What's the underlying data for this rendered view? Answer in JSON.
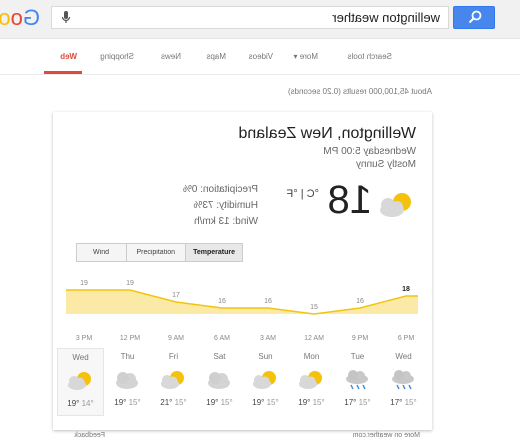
{
  "search": {
    "query": "wellington weather",
    "logo_text": "Google"
  },
  "nav": {
    "items": [
      "Web",
      "Shopping",
      "News",
      "Maps",
      "Videos",
      "More ▾",
      "Search tools"
    ]
  },
  "stats": "About 45,100,000 results (0.20 seconds)",
  "weather": {
    "location": "Wellington, New Zealand",
    "datetime": "Wednesday 5:00 PM",
    "condition": "Mostly Sunny",
    "temperature": "18",
    "units": "°C | °F",
    "precipitation": "Precipitation: 0%",
    "humidity": "Humidity: 73%",
    "wind": "Wind: 13 km/h",
    "tabs": [
      "Temperature",
      "Precipitation",
      "Wind"
    ],
    "selected_tab": "Temperature",
    "days": [
      {
        "name": "Wed",
        "high": "19°",
        "low": "14°",
        "icon": "partly-sunny-icon"
      },
      {
        "name": "Thu",
        "high": "19°",
        "low": "15°",
        "icon": "cloudy-icon"
      },
      {
        "name": "Fri",
        "high": "21°",
        "low": "15°",
        "icon": "partly-sunny-icon"
      },
      {
        "name": "Sat",
        "high": "19°",
        "low": "15°",
        "icon": "cloudy-icon"
      },
      {
        "name": "Sun",
        "high": "19°",
        "low": "15°",
        "icon": "partly-sunny-icon"
      },
      {
        "name": "Mon",
        "high": "19°",
        "low": "15°",
        "icon": "partly-sunny-icon"
      },
      {
        "name": "Tue",
        "high": "17°",
        "low": "15°",
        "icon": "rain-icon"
      },
      {
        "name": "Wed",
        "high": "17°",
        "low": "15°",
        "icon": "rain-icon"
      }
    ],
    "source": "More on weather.com",
    "feedback": "Feedback"
  },
  "chart_data": {
    "type": "area",
    "x": [
      "6 PM",
      "9 PM",
      "12 AM",
      "3 AM",
      "6 AM",
      "9 AM",
      "12 PM",
      "3 PM"
    ],
    "values": [
      18,
      16,
      15,
      16,
      16,
      17,
      19,
      19
    ],
    "labels": [
      "18",
      "16",
      "15",
      "16",
      "16",
      "17",
      "19",
      "19"
    ],
    "colors": {
      "fill": "#fbe9a6",
      "line": "#f2c412"
    }
  }
}
